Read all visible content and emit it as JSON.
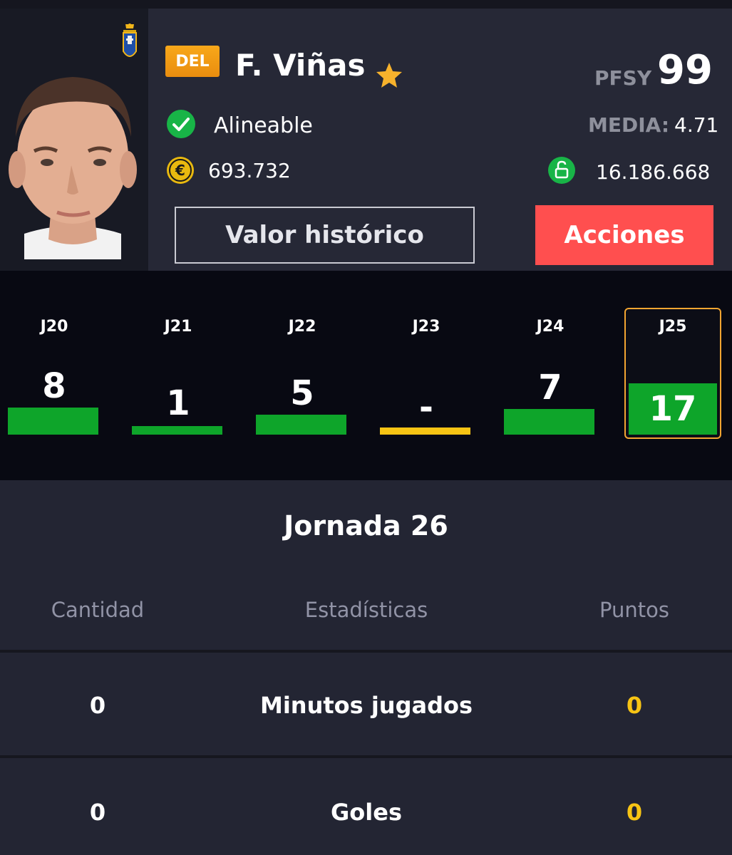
{
  "player": {
    "position": "DEL",
    "name": "F. Viñas",
    "pfsy_label": "PFSY",
    "pfsy_value": "99",
    "status": "Alineable",
    "media_label": "MEDIA:",
    "media_value": "4.71",
    "market_value": "693.732",
    "clause_value": "16.186.668"
  },
  "buttons": {
    "history": "Valor histórico",
    "actions": "Acciones"
  },
  "colors": {
    "accent_orange": "#f2a531",
    "score_green": "#0ea52a",
    "no_play_yellow": "#f7c414",
    "action_red": "#ff4f4f"
  },
  "rounds": [
    {
      "label": "J20",
      "score": "8"
    },
    {
      "label": "J21",
      "score": "1"
    },
    {
      "label": "J22",
      "score": "5"
    },
    {
      "label": "J23",
      "score": "-"
    },
    {
      "label": "J24",
      "score": "7"
    },
    {
      "label": "J25",
      "score": "17"
    }
  ],
  "stats": {
    "title": "Jornada 26",
    "headers": {
      "quantity": "Cantidad",
      "stat": "Estadísticas",
      "points": "Puntos"
    },
    "rows": [
      {
        "quantity": "0",
        "stat": "Minutos jugados",
        "points": "0"
      },
      {
        "quantity": "0",
        "stat": "Goles",
        "points": "0"
      }
    ]
  },
  "icons": [
    "team-crest-icon",
    "star-icon",
    "check-icon",
    "euro-icon",
    "lock-icon"
  ]
}
